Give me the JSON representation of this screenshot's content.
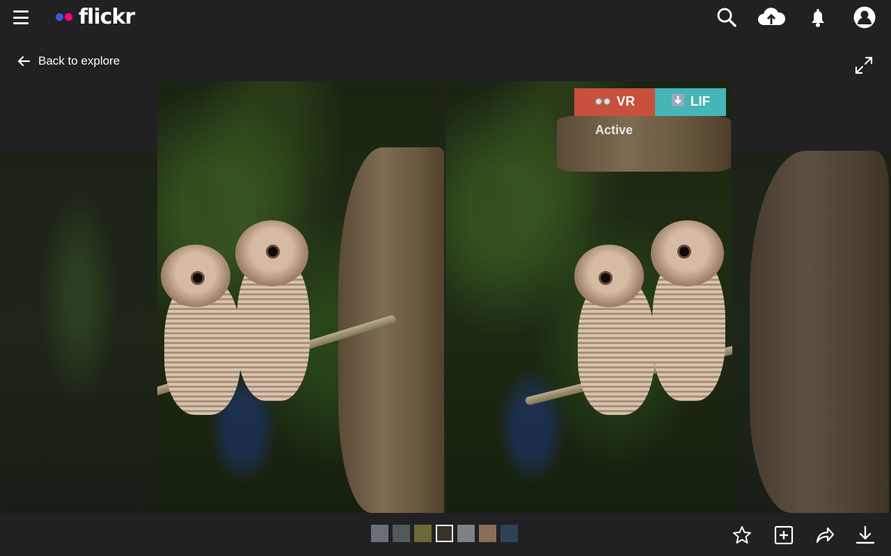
{
  "header": {
    "logo_text": "flickr",
    "logo_colors": [
      "#3b5bdb",
      "#ff0084"
    ],
    "icons": [
      "search-icon",
      "upload-cloud-icon",
      "bell-icon",
      "account-icon"
    ]
  },
  "nav": {
    "back_label": "Back to explore"
  },
  "viewer": {
    "vr_label": "VR",
    "lif_label": "LIF",
    "status": "Active",
    "vr_color": "#c8503c",
    "lif_color": "#45b5b5"
  },
  "filmstrip": {
    "thumbnails": [
      {
        "name": "thumb-1",
        "color": "#6a7078"
      },
      {
        "name": "thumb-2",
        "color": "#505a58"
      },
      {
        "name": "thumb-3",
        "color": "#6b6a35"
      },
      {
        "name": "thumb-4",
        "color": "#3a3228",
        "active": true
      },
      {
        "name": "thumb-5",
        "color": "#7e8286"
      },
      {
        "name": "thumb-6",
        "color": "#8a6e58"
      },
      {
        "name": "thumb-7",
        "color": "#2f4155"
      }
    ]
  },
  "actions": [
    "favorite-star-icon",
    "add-to-gallery-icon",
    "share-icon",
    "download-icon"
  ]
}
